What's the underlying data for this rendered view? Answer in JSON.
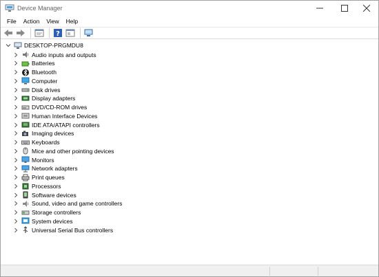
{
  "window": {
    "title": "Device Manager"
  },
  "menu": [
    "File",
    "Action",
    "View",
    "Help"
  ],
  "toolbar": [
    {
      "name": "back-icon"
    },
    {
      "name": "forward-icon"
    },
    {
      "name": "properties-icon"
    },
    {
      "name": "help-icon"
    },
    {
      "name": "show-hide-icon"
    },
    {
      "name": "scan-hardware-icon"
    }
  ],
  "tree": {
    "root": {
      "label": "DESKTOP-PRGMDU8",
      "expanded": true
    },
    "categories": [
      {
        "label": "Audio inputs and outputs",
        "icon": "speaker-icon"
      },
      {
        "label": "Batteries",
        "icon": "battery-icon"
      },
      {
        "label": "Bluetooth",
        "icon": "bluetooth-icon"
      },
      {
        "label": "Computer",
        "icon": "computer-icon"
      },
      {
        "label": "Disk drives",
        "icon": "disk-drive-icon"
      },
      {
        "label": "Display adapters",
        "icon": "display-adapter-icon"
      },
      {
        "label": "DVD/CD-ROM drives",
        "icon": "dvd-drive-icon"
      },
      {
        "label": "Human Interface Devices",
        "icon": "hid-icon"
      },
      {
        "label": "IDE ATA/ATAPI controllers",
        "icon": "ide-controller-icon"
      },
      {
        "label": "Imaging devices",
        "icon": "camera-icon"
      },
      {
        "label": "Keyboards",
        "icon": "keyboard-icon"
      },
      {
        "label": "Mice and other pointing devices",
        "icon": "mouse-icon"
      },
      {
        "label": "Monitors",
        "icon": "monitor-icon"
      },
      {
        "label": "Network adapters",
        "icon": "network-adapter-icon"
      },
      {
        "label": "Print queues",
        "icon": "printer-icon"
      },
      {
        "label": "Processors",
        "icon": "processor-icon"
      },
      {
        "label": "Software devices",
        "icon": "software-device-icon"
      },
      {
        "label": "Sound, video and game controllers",
        "icon": "sound-controller-icon"
      },
      {
        "label": "Storage controllers",
        "icon": "storage-controller-icon"
      },
      {
        "label": "System devices",
        "icon": "system-devices-icon"
      },
      {
        "label": "Universal Serial Bus controllers",
        "icon": "usb-icon"
      }
    ]
  }
}
